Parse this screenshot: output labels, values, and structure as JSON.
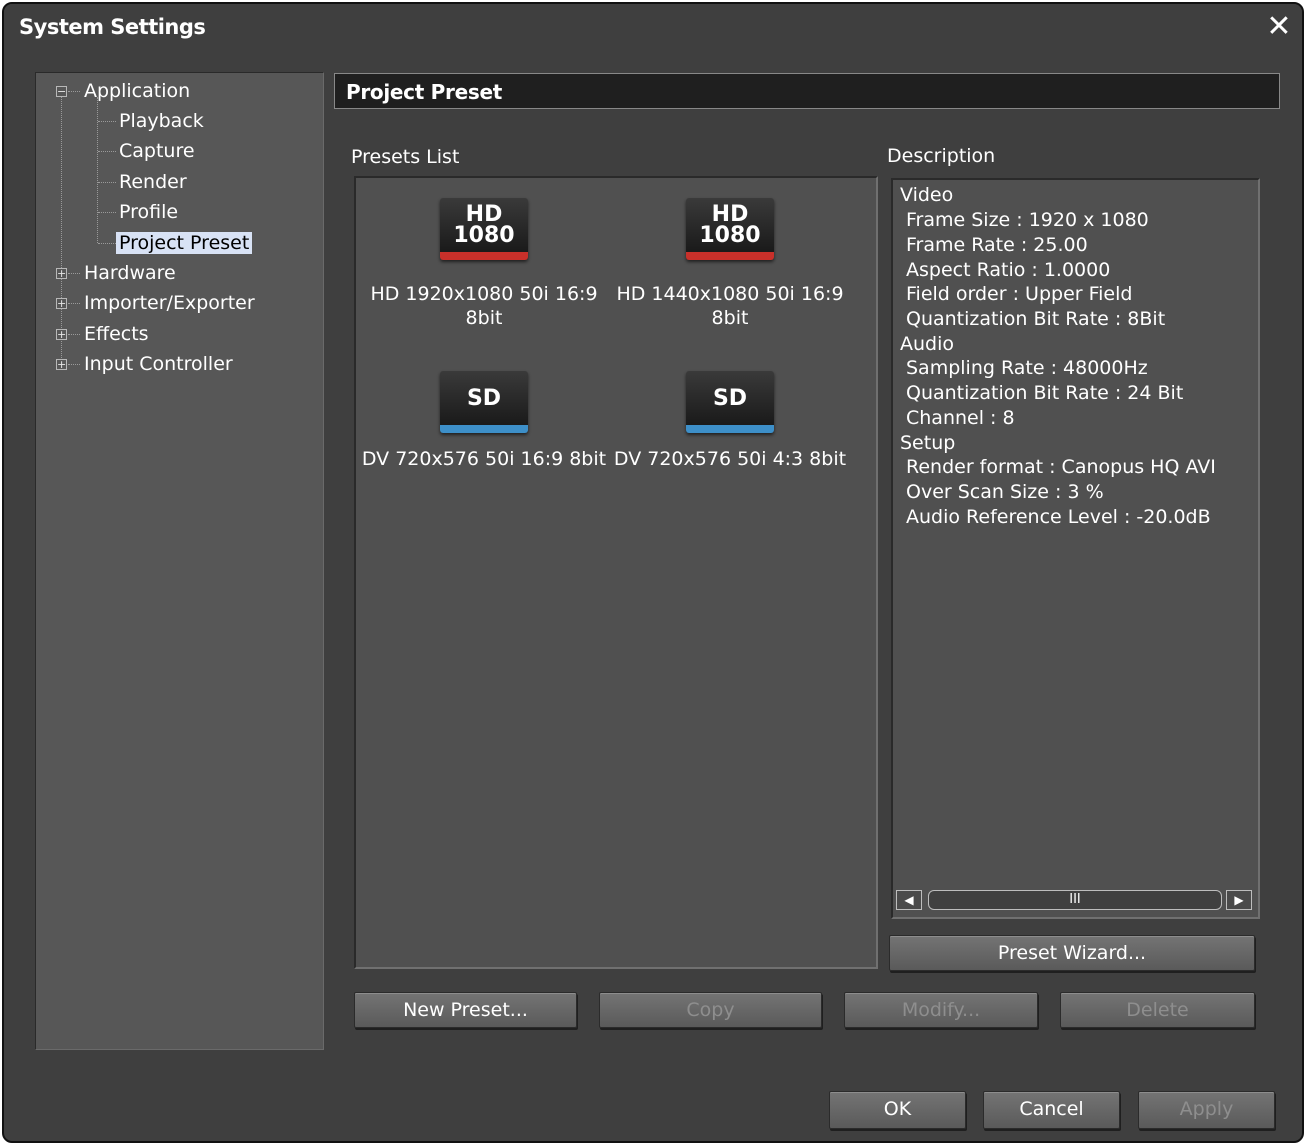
{
  "window": {
    "title": "System Settings"
  },
  "tree": {
    "application": "Application",
    "application_children": [
      "Playback",
      "Capture",
      "Render",
      "Profile",
      "Project Preset"
    ],
    "others": [
      "Hardware",
      "Importer/Exporter",
      "Effects",
      "Input Controller"
    ],
    "selected": "Project Preset"
  },
  "panel": {
    "title": "Project Preset"
  },
  "presets": {
    "list_label": "Presets List",
    "items": [
      {
        "badge": "HD",
        "badge_sub": "1080",
        "line1": "HD 1920x1080 50i 16:9",
        "line2": "8bit",
        "stripe_color": "#c8302a"
      },
      {
        "badge": "HD",
        "badge_sub": "1080",
        "line1": "HD 1440x1080 50i 16:9",
        "line2": "8bit",
        "stripe_color": "#c8302a"
      },
      {
        "badge": "SD",
        "badge_sub": "",
        "line1": "DV 720x576 50i 16:9 8bit",
        "line2": "",
        "stripe_color": "#3d8fc8"
      },
      {
        "badge": "SD",
        "badge_sub": "",
        "line1": "DV 720x576 50i 4:3 8bit",
        "line2": "",
        "stripe_color": "#3d8fc8"
      }
    ]
  },
  "description": {
    "label": "Description",
    "lines": [
      "Video",
      "Frame Size : 1920 x 1080",
      "Frame Rate : 25.00",
      "Aspect Ratio : 1.0000",
      "Field order : Upper Field",
      "Quantization Bit Rate : 8Bit",
      "Audio",
      "Sampling Rate : 48000Hz",
      "Quantization Bit Rate : 24 Bit",
      "Channel : 8",
      "Setup",
      "Render format : Canopus HQ AVI",
      "Over Scan Size : 3 %",
      "Audio Reference Level : -20.0dB"
    ],
    "scroll_thumb": "III"
  },
  "buttons": {
    "preset_wizard": "Preset Wizard...",
    "new_preset": "New Preset...",
    "copy": "Copy",
    "modify": "Modify...",
    "delete": "Delete",
    "ok": "OK",
    "cancel": "Cancel",
    "apply": "Apply"
  }
}
